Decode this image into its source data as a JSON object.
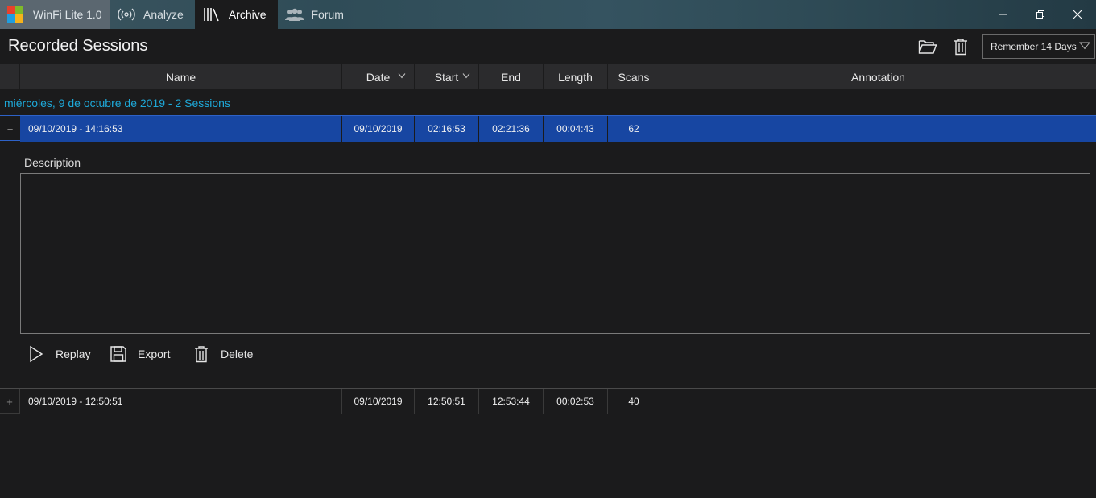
{
  "window": {
    "app_name": "WinFi Lite 1.0",
    "tabs": [
      {
        "label": "Analyze",
        "icon": "radio-waves-icon"
      },
      {
        "label": "Archive",
        "icon": "library-icon"
      },
      {
        "label": "Forum",
        "icon": "users-icon"
      }
    ],
    "active_tab": "Archive"
  },
  "header": {
    "title": "Recorded Sessions",
    "retention": "Remember 14 Days"
  },
  "table": {
    "columns": [
      "Name",
      "Date",
      "Start",
      "End",
      "Length",
      "Scans",
      "Annotation"
    ],
    "group": "miércoles, 9 de octubre de 2019  -  2 Sessions",
    "rows": [
      {
        "expander": "−",
        "name": "09/10/2019  -  14:16:53",
        "date": "09/10/2019",
        "start": "02:16:53",
        "end": "02:21:36",
        "length": "00:04:43",
        "scans": "62",
        "annotation": "",
        "selected": true
      },
      {
        "expander": "+",
        "name": "09/10/2019  -  12:50:51",
        "date": "09/10/2019",
        "start": "12:50:51",
        "end": "12:53:44",
        "length": "00:02:53",
        "scans": "40",
        "annotation": "",
        "selected": false
      }
    ]
  },
  "details": {
    "description_label": "Description",
    "description_value": "",
    "actions": [
      "Replay",
      "Export",
      "Delete"
    ]
  },
  "colors": {
    "accent": "#1746a2",
    "group_text": "#1ea8d8",
    "background": "#1b1b1c"
  }
}
